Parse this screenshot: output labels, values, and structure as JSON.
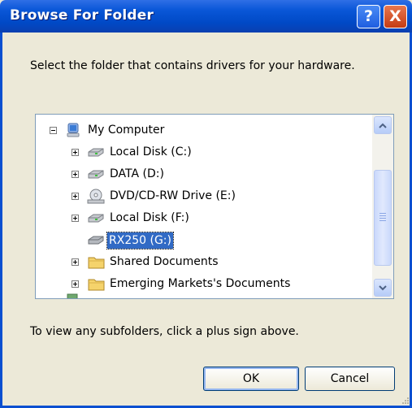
{
  "dialog": {
    "title": "Browse For Folder",
    "help_label": "?",
    "close_label": "X",
    "instruction": "Select the folder that contains drivers for your hardware.",
    "hint": "To view any subfolders, click a plus sign above.",
    "ok_label": "OK",
    "cancel_label": "Cancel"
  },
  "tree": {
    "root": {
      "label": "My Computer",
      "icon": "my-computer-icon",
      "expanded": true
    },
    "items": [
      {
        "label": "Local Disk (C:)",
        "icon": "hard-drive-icon",
        "expander": "plus"
      },
      {
        "label": "DATA (D:)",
        "icon": "hard-drive-icon",
        "expander": "plus"
      },
      {
        "label": "DVD/CD-RW Drive (E:)",
        "icon": "cd-drive-icon",
        "expander": "plus"
      },
      {
        "label": "Local Disk (F:)",
        "icon": "hard-drive-icon",
        "expander": "plus"
      },
      {
        "label": "RX250 (G:)",
        "icon": "removable-drive-icon",
        "expander": "none",
        "selected": true
      },
      {
        "label": "Shared Documents",
        "icon": "folder-icon",
        "expander": "plus"
      },
      {
        "label": "Emerging Markets's Documents",
        "icon": "folder-icon",
        "expander": "plus"
      }
    ]
  },
  "colors": {
    "titlebar": "#0a4fd0",
    "selection_bg": "#316ac5",
    "folder": "#f5d36b"
  }
}
